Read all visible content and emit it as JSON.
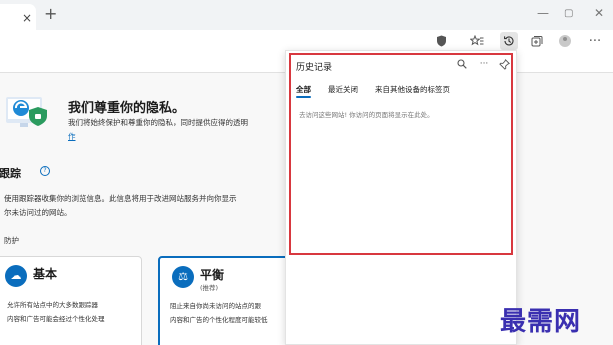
{
  "tabbar": {
    "tab_close": "×",
    "new_tab": "+",
    "minimize": "—",
    "restore": "▢",
    "close": "✕"
  },
  "toolbar": {
    "icons": [
      "favorites-add-icon",
      "tracking-icon",
      "shield-icon",
      "favorites-icon",
      "history-icon",
      "collections-icon",
      "profile-icon",
      "more-icon"
    ],
    "more": "···"
  },
  "privacy": {
    "heading": "我们尊重你的隐私。",
    "desc": "我们将始终保护和尊重你的隐私，同时提供应得的透明",
    "link": "作"
  },
  "tracking": {
    "heading": "跟踪",
    "desc_line1": "使用跟踪器收集你的浏览信息。此信息将用于改进网站服务并向你显示",
    "desc_line2": "尔未访问过的网站。",
    "protect_label": "防护"
  },
  "cards": {
    "basic": {
      "title": "基本",
      "lines": [
        "允许所有站点中的大多数跟踪器",
        "内容和广告可能会经过个性化处理"
      ]
    },
    "balanced": {
      "title": "平衡",
      "sub": "(推荐)",
      "lines": [
        "阻止来自你尚未访问的站点的跟",
        "内容和广告的个性化程度可能较低"
      ]
    }
  },
  "history": {
    "title": "历史记录",
    "tabs": [
      "全部",
      "最近关闭",
      "来自其他设备的标签页"
    ],
    "active_tab": "全部",
    "empty_message": "去访问这些网站! 你访问的页面将显示在此处。",
    "more": "···"
  },
  "watermark": "最需网",
  "colors": {
    "accent": "#0a6dbd",
    "highlight": "#d8383f",
    "watermark": "#3a2fb0"
  }
}
